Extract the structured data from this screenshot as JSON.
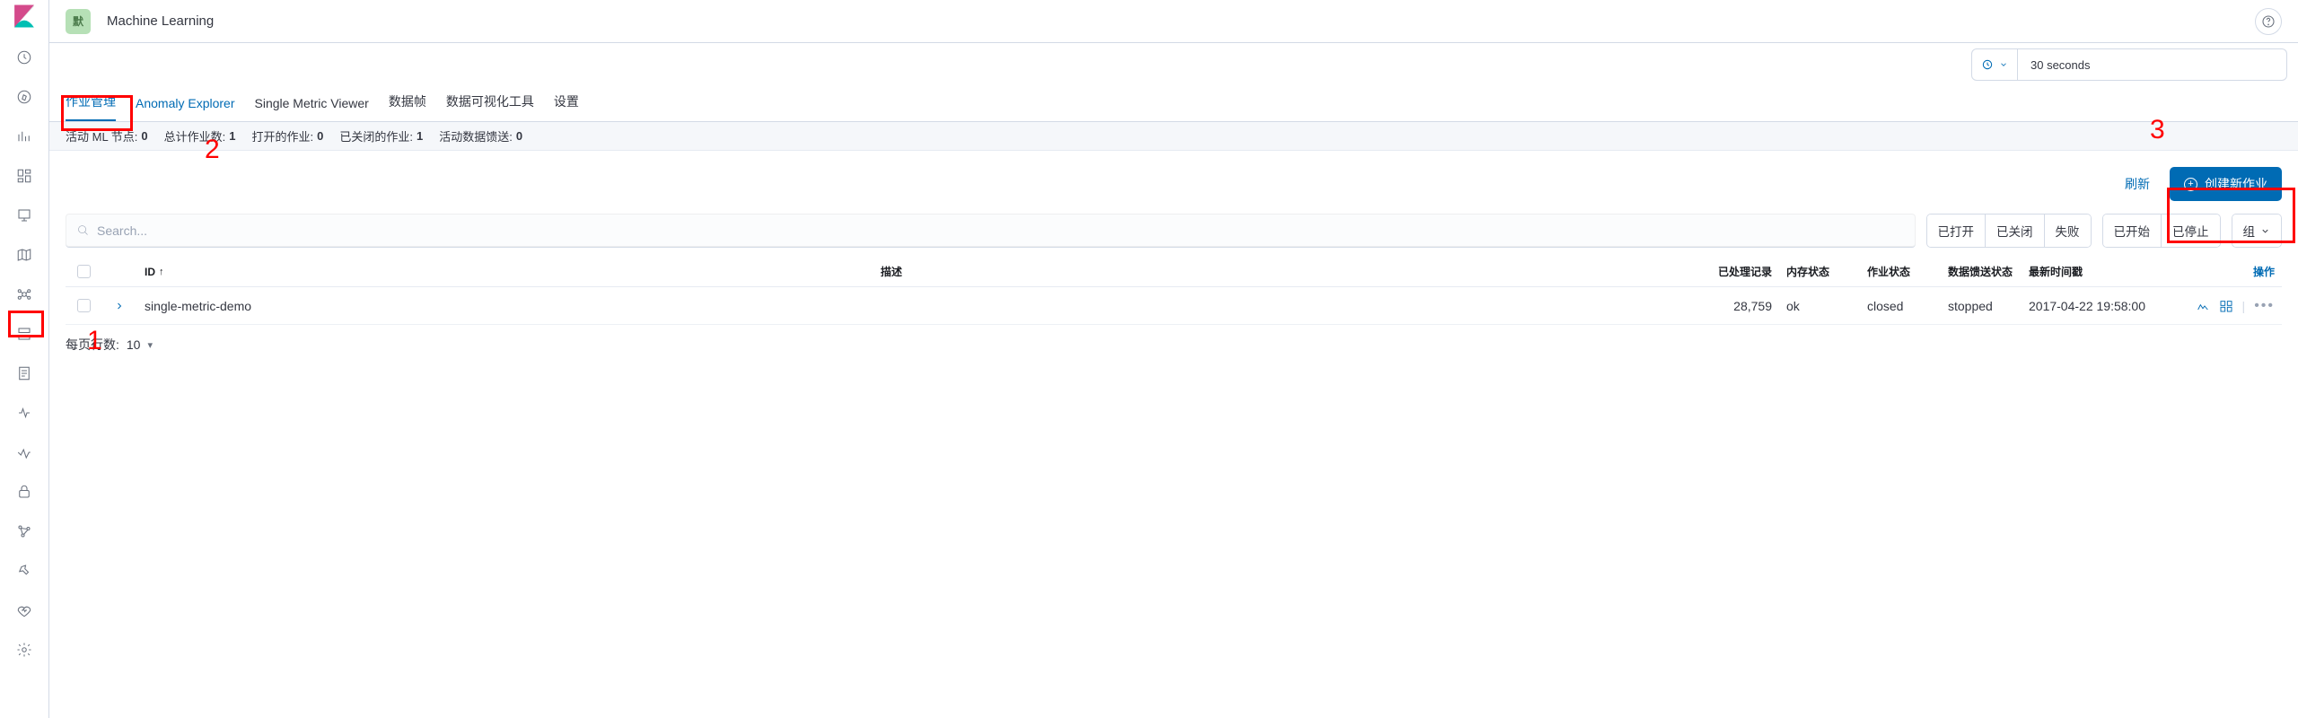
{
  "header": {
    "space_initial": "默",
    "app_title": "Machine Learning"
  },
  "time_picker": {
    "interval": "30 seconds"
  },
  "tabs": [
    {
      "label": "作业管理",
      "selected": true
    },
    {
      "label": "Anomaly Explorer",
      "selected": false
    },
    {
      "label": "Single Metric Viewer",
      "selected": false
    },
    {
      "label": "数据帧",
      "selected": false
    },
    {
      "label": "数据可视化工具",
      "selected": false
    },
    {
      "label": "设置",
      "selected": false
    }
  ],
  "stats": {
    "active_nodes_label": "活动 ML 节点:",
    "active_nodes": "0",
    "total_jobs_label": "总计作业数:",
    "total_jobs": "1",
    "open_jobs_label": "打开的作业:",
    "open_jobs": "0",
    "closed_jobs_label": "已关闭的作业:",
    "closed_jobs": "1",
    "active_feeds_label": "活动数据馈送:",
    "active_feeds": "0"
  },
  "actions": {
    "refresh": "刷新",
    "create": "创建新作业"
  },
  "search": {
    "placeholder": "Search..."
  },
  "filters": {
    "opened": "已打开",
    "closed": "已关闭",
    "failed": "失败",
    "started": "已开始",
    "stopped": "已停止",
    "group": "组"
  },
  "columns": {
    "id": "ID",
    "desc": "描述",
    "processed": "已处理记录",
    "mem": "内存状态",
    "jobstate": "作业状态",
    "feedstate": "数据馈送状态",
    "ts": "最新时间戳",
    "ops": "操作"
  },
  "rows": [
    {
      "id": "single-metric-demo",
      "desc": "",
      "processed": "28,759",
      "mem": "ok",
      "jobstate": "closed",
      "feedstate": "stopped",
      "ts": "2017-04-22 19:58:00"
    }
  ],
  "pager": {
    "label": "每页行数:",
    "size": "10"
  },
  "callouts": {
    "n1": "1",
    "n2": "2",
    "n3": "3"
  }
}
